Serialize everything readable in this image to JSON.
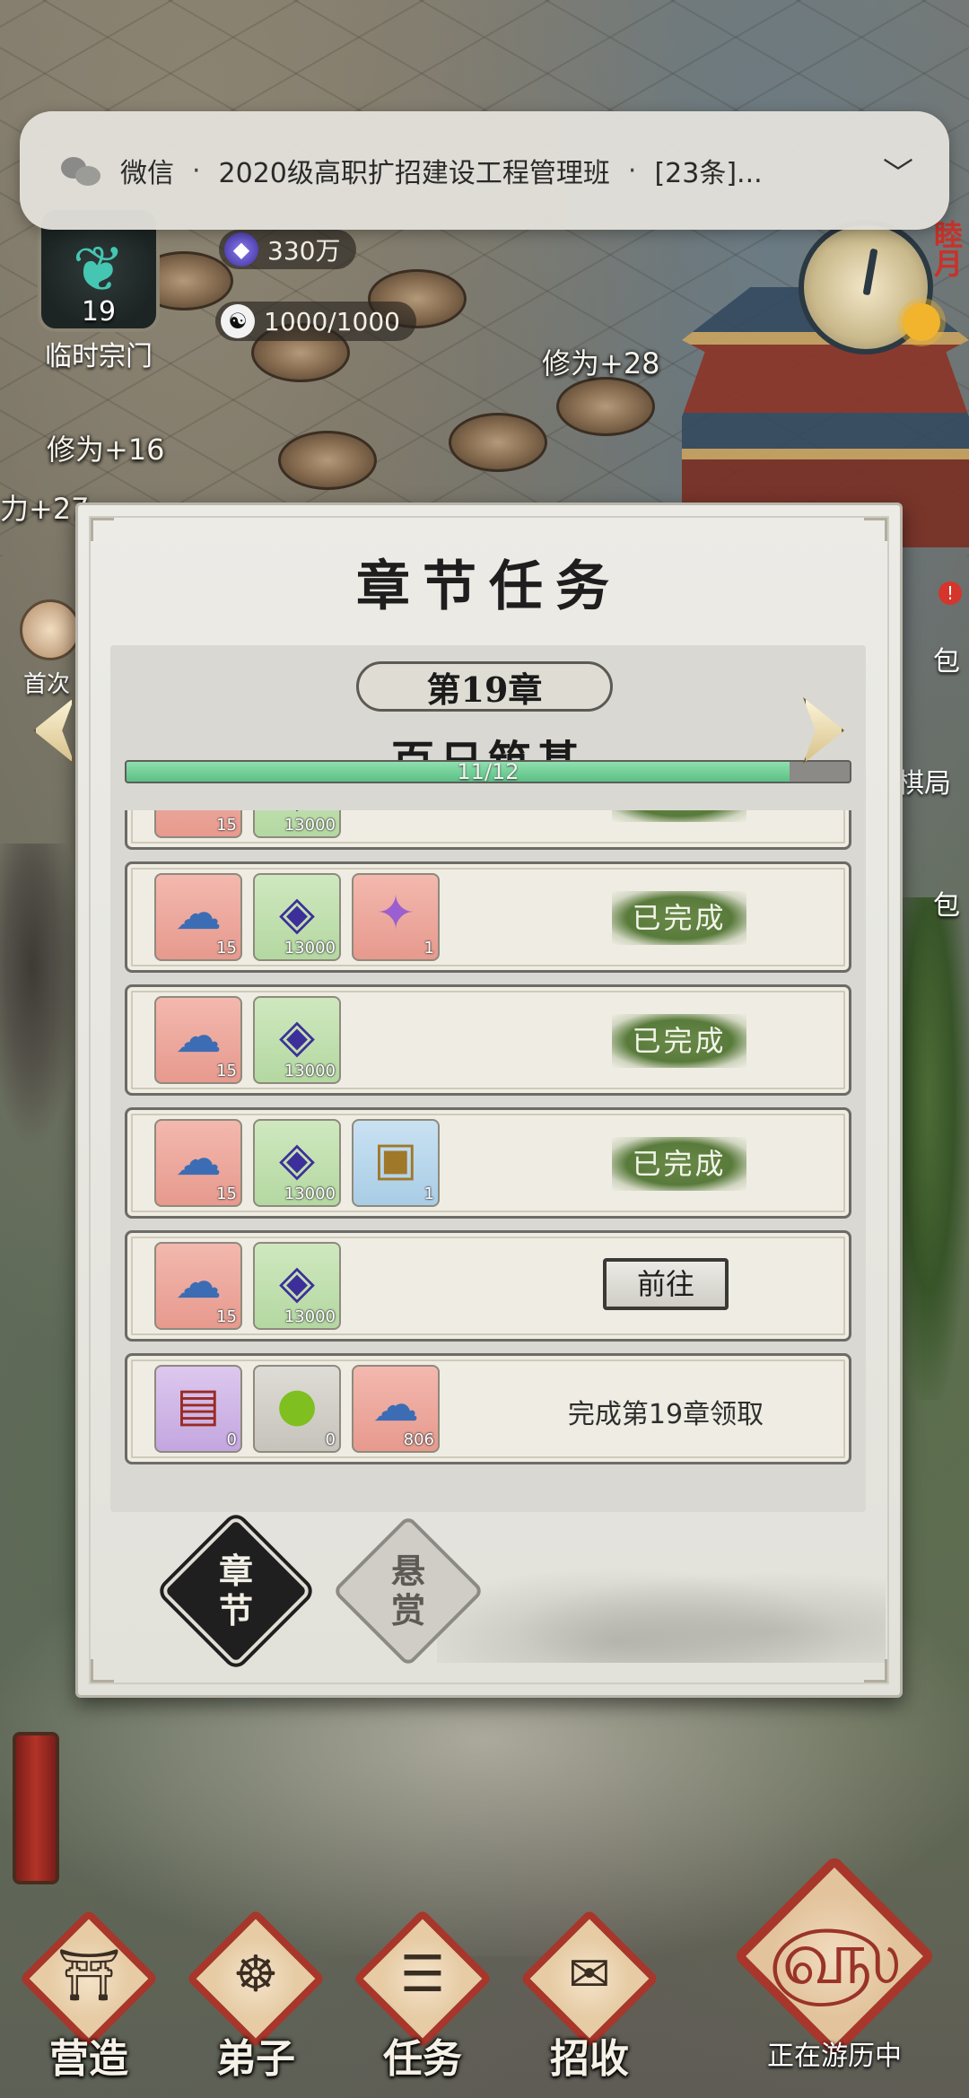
{
  "notification": {
    "app": "微信",
    "separator": "·",
    "group": "2020级高职扩招建设工程管理班",
    "preview": "[23条]...",
    "icon": "wechat-icon",
    "chevron": "chevron-down-icon"
  },
  "hud": {
    "spirit_stones": "330万",
    "yin_yang": "1000/1000",
    "sect_level": "19",
    "sect_name": "临时宗门",
    "month_tag": "睦月",
    "first_label": "首次"
  },
  "floating_texts": [
    "修为+28",
    "修为+16",
    "力+27"
  ],
  "side_labels": [
    "包",
    "棋局",
    "包"
  ],
  "dialog": {
    "title": "章节任务",
    "chapter_number": "第19章",
    "chapter_name": "百日筑基",
    "progress_text": "11/12",
    "progress": {
      "current": 11,
      "total": 12
    },
    "tasks": [
      {
        "rewards": [
          {
            "icon": "cloud-token-icon",
            "color": "red",
            "qty": "15"
          },
          {
            "icon": "spirit-crystal-icon",
            "color": "green",
            "qty": "13000"
          }
        ],
        "status": "done",
        "status_label": "已完成"
      },
      {
        "rewards": [
          {
            "icon": "cloud-token-icon",
            "color": "red",
            "qty": "15"
          },
          {
            "icon": "spirit-crystal-icon",
            "color": "green",
            "qty": "13000"
          },
          {
            "icon": "purple-powder-icon",
            "color": "red",
            "qty": "1"
          }
        ],
        "status": "done",
        "status_label": "已完成"
      },
      {
        "rewards": [
          {
            "icon": "cloud-token-icon",
            "color": "red",
            "qty": "15"
          },
          {
            "icon": "spirit-crystal-icon",
            "color": "green",
            "qty": "13000"
          }
        ],
        "status": "done",
        "status_label": "已完成"
      },
      {
        "rewards": [
          {
            "icon": "cloud-token-icon",
            "color": "red",
            "qty": "15"
          },
          {
            "icon": "spirit-crystal-icon",
            "color": "green",
            "qty": "13000"
          },
          {
            "icon": "treasure-chest-icon",
            "color": "blue",
            "qty": "1"
          }
        ],
        "status": "done",
        "status_label": "已完成"
      },
      {
        "rewards": [
          {
            "icon": "cloud-token-icon",
            "color": "red",
            "qty": "15"
          },
          {
            "icon": "spirit-crystal-icon",
            "color": "green",
            "qty": "13000"
          }
        ],
        "status": "go",
        "status_label": "前往"
      },
      {
        "rewards": [
          {
            "icon": "red-chest-icon",
            "color": "purple",
            "qty": "0"
          },
          {
            "icon": "green-pearl-icon",
            "color": "grey",
            "qty": "0"
          },
          {
            "icon": "cloud-token-icon",
            "color": "red",
            "qty": "806"
          }
        ],
        "status": "claim",
        "status_label": "完成第19章领取"
      }
    ],
    "tabs": [
      {
        "label_top": "章",
        "label_bottom": "节",
        "active": true
      },
      {
        "label_top": "悬",
        "label_bottom": "赏",
        "active": false
      }
    ]
  },
  "nav": [
    {
      "label": "营造",
      "icon": "building-icon"
    },
    {
      "label": "弟子",
      "icon": "disciple-icon"
    },
    {
      "label": "任务",
      "icon": "scroll-icon"
    },
    {
      "label": "招收",
      "icon": "card-icon"
    }
  ],
  "travel": {
    "label": "正在游历中",
    "icon": "travel-swirl-icon"
  },
  "colors": {
    "accent_red": "#a8362a",
    "progress_green": "#5bbf85",
    "done_green": "#587a3a"
  }
}
